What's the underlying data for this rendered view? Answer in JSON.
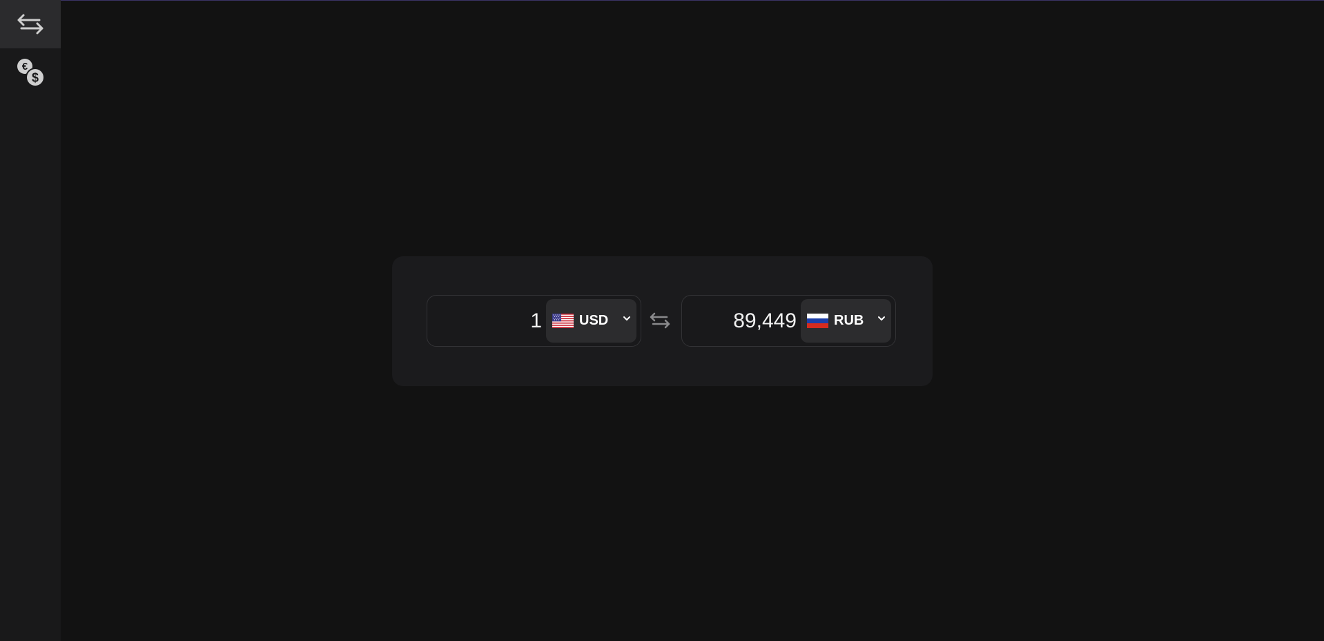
{
  "sidebar": {
    "items": [
      {
        "icon": "swap-arrows-icon",
        "active": true
      },
      {
        "icon": "currency-coins-icon",
        "active": false
      }
    ]
  },
  "converter": {
    "from": {
      "amount": "1",
      "currency": "USD",
      "flag": "us-flag-icon"
    },
    "to": {
      "amount": "89,449",
      "currency": "RUB",
      "flag": "ru-flag-icon"
    },
    "swap_icon": "swap-arrows-icon"
  },
  "colors": {
    "background": "#121212",
    "sidebar": "#19191a",
    "card": "#1b1b1d",
    "select": "#2c2c2e",
    "accent_line": "#3b3466"
  }
}
